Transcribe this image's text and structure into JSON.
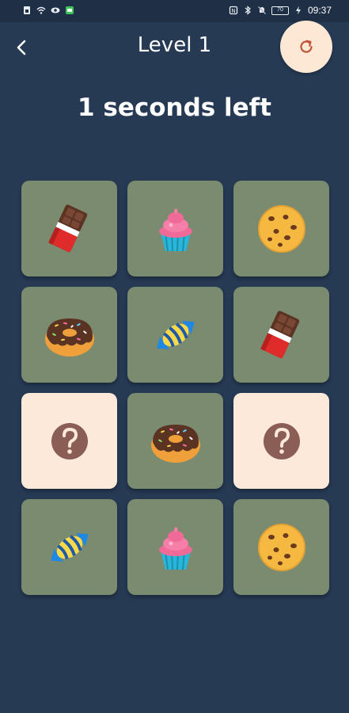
{
  "status_bar": {
    "time": "09:37",
    "battery": "70",
    "left_icons": [
      "sim-icon",
      "wifi-icon",
      "eye-icon",
      "message-icon"
    ],
    "right_icons": [
      "nfc-icon",
      "bluetooth-icon",
      "mute-icon",
      "battery-icon",
      "charging-icon"
    ]
  },
  "header": {
    "title": "Level 1",
    "back_icon": "chevron-left-icon",
    "restart_icon": "restart-icon"
  },
  "timer": {
    "text": "1 seconds left"
  },
  "cards": [
    {
      "state": "revealed",
      "item": "chocolate"
    },
    {
      "state": "revealed",
      "item": "cupcake"
    },
    {
      "state": "revealed",
      "item": "cookie"
    },
    {
      "state": "revealed",
      "item": "donut"
    },
    {
      "state": "revealed",
      "item": "candy"
    },
    {
      "state": "revealed",
      "item": "chocolate"
    },
    {
      "state": "hidden",
      "item": "question"
    },
    {
      "state": "revealed",
      "item": "donut"
    },
    {
      "state": "hidden",
      "item": "question"
    },
    {
      "state": "revealed",
      "item": "candy"
    },
    {
      "state": "revealed",
      "item": "cupcake"
    },
    {
      "state": "revealed",
      "item": "cookie"
    }
  ],
  "colors": {
    "background": "#263a54",
    "card_revealed": "#7a8b6f",
    "card_hidden": "#fde9d9",
    "restart_bg": "#fce8d5",
    "accent": "#c0553b"
  }
}
